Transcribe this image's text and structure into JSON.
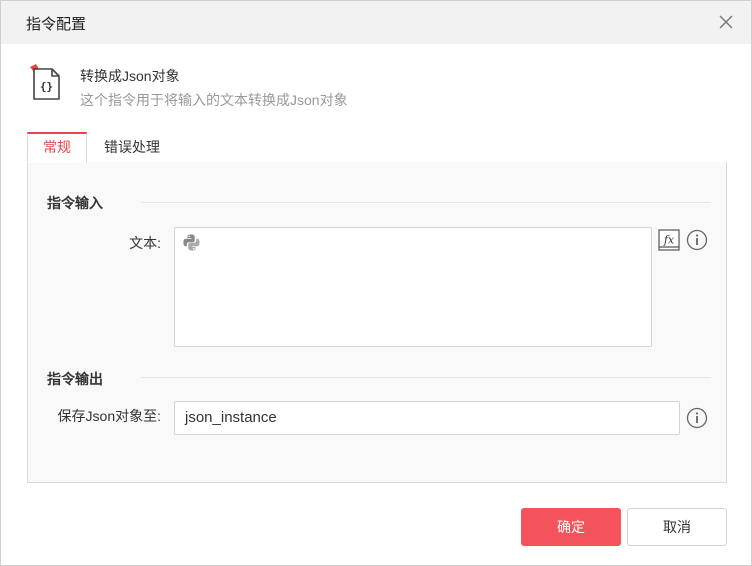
{
  "dialog": {
    "title": "指令配置",
    "close_icon": "close-icon"
  },
  "command": {
    "icon": "json-braces-icon",
    "title": "转换成Json对象",
    "description": "这个指令用于将输入的文本转换成Json对象"
  },
  "tabs": [
    {
      "label": "常规",
      "active": true
    },
    {
      "label": "错误处理",
      "active": false
    }
  ],
  "input_section": {
    "title": "指令输入",
    "text_field": {
      "label": "文本:",
      "value": "",
      "mode_icon": "python-icon",
      "expression_icon": "fx-icon",
      "info_icon": "info-icon"
    }
  },
  "output_section": {
    "title": "指令输出",
    "save_field": {
      "label": "保存Json对象至:",
      "value": "json_instance",
      "info_icon": "info-icon"
    }
  },
  "buttons": {
    "ok": "确定",
    "cancel": "取消"
  },
  "colors": {
    "accent": "#e8434b",
    "primary_button": "#f4535b",
    "panel_bg": "#f9f9f9",
    "titlebar_bg": "#f2f2f2"
  }
}
